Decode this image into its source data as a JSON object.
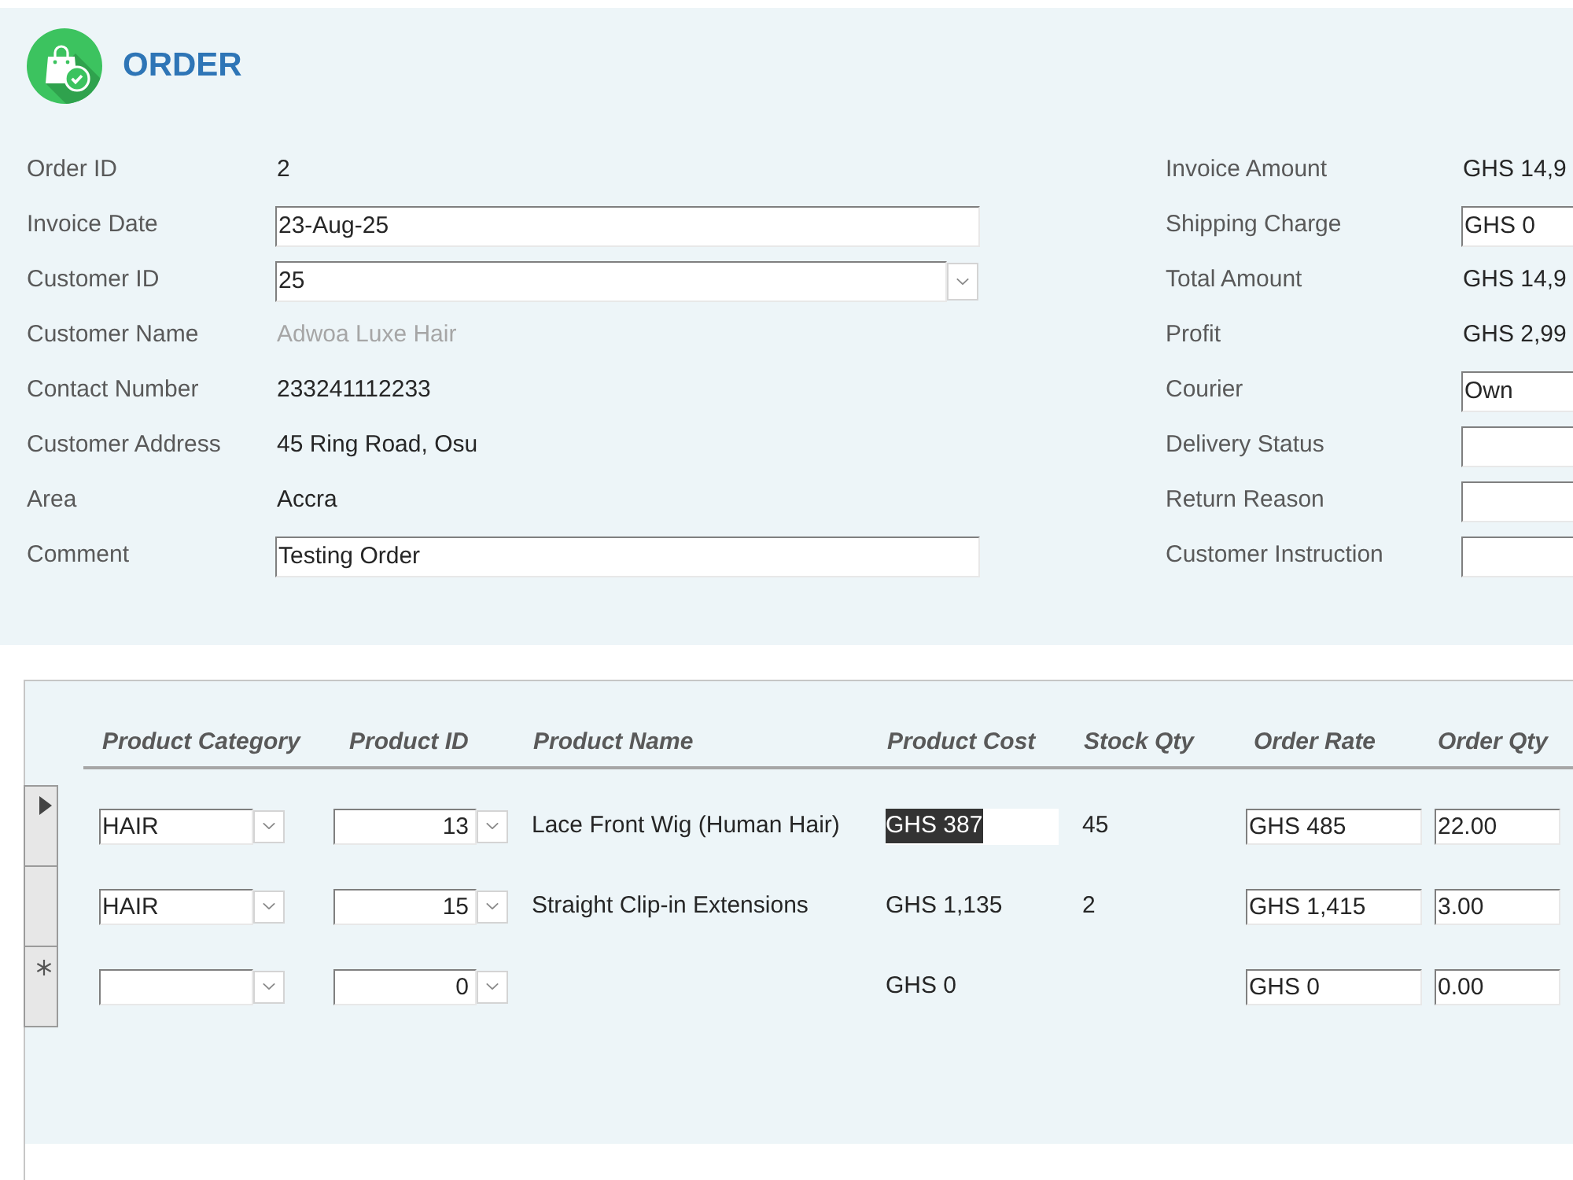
{
  "header": {
    "title": "ORDER"
  },
  "order_fields": [
    {
      "label": "Order ID",
      "kind": "value",
      "value": "2"
    },
    {
      "label": "Invoice Date",
      "kind": "input",
      "value": "23-Aug-25"
    },
    {
      "label": "Customer ID",
      "kind": "combo",
      "value": "25"
    },
    {
      "label": "Customer Name",
      "kind": "faded",
      "value": "Adwoa Luxe Hair"
    },
    {
      "label": "Contact Number",
      "kind": "value",
      "value": "233241112233"
    },
    {
      "label": "Customer Address",
      "kind": "value",
      "value": "45 Ring Road, Osu"
    },
    {
      "label": "Area",
      "kind": "value",
      "value": "Accra"
    },
    {
      "label": "Comment",
      "kind": "input",
      "value": "Testing Order"
    }
  ],
  "amount_fields": [
    {
      "label": "Invoice Amount",
      "kind": "value",
      "value": "GHS 14,9"
    },
    {
      "label": "Shipping Charge",
      "kind": "input",
      "value": "GHS 0"
    },
    {
      "label": "Total Amount",
      "kind": "value",
      "value": "GHS 14,9"
    },
    {
      "label": "Profit",
      "kind": "value",
      "value": "GHS 2,99"
    },
    {
      "label": "Courier",
      "kind": "input",
      "value": "Own"
    },
    {
      "label": "Delivery Status",
      "kind": "input"
    },
    {
      "label": "Return Reason",
      "kind": "input"
    },
    {
      "label": "Customer Instruction",
      "kind": "input"
    }
  ],
  "line_items": {
    "columns": [
      "Product Category",
      "Product ID",
      "Product Name",
      "Product Cost",
      "Stock Qty",
      "Order Rate",
      "Order Qty"
    ],
    "rows": [
      {
        "kind": "record",
        "current": true,
        "product_category": "HAIR",
        "product_id": "13",
        "product_name": "Lace Front Wig (Human Hair)",
        "product_cost": "GHS 387",
        "cost_selected": true,
        "stock_qty": "45",
        "order_rate": "GHS 485",
        "order_qty": "22.00"
      },
      {
        "kind": "record",
        "current": false,
        "product_category": "HAIR",
        "product_id": "15",
        "product_name": "Straight Clip-in Extensions",
        "product_cost": "GHS 1,135",
        "cost_selected": false,
        "stock_qty": "2",
        "order_rate": "GHS 1,415",
        "order_qty": "3.00"
      },
      {
        "kind": "new",
        "current": false,
        "product_id": "0",
        "product_cost": "GHS 0",
        "cost_selected": false,
        "order_rate": "GHS 0",
        "order_qty": "0.00"
      }
    ]
  }
}
